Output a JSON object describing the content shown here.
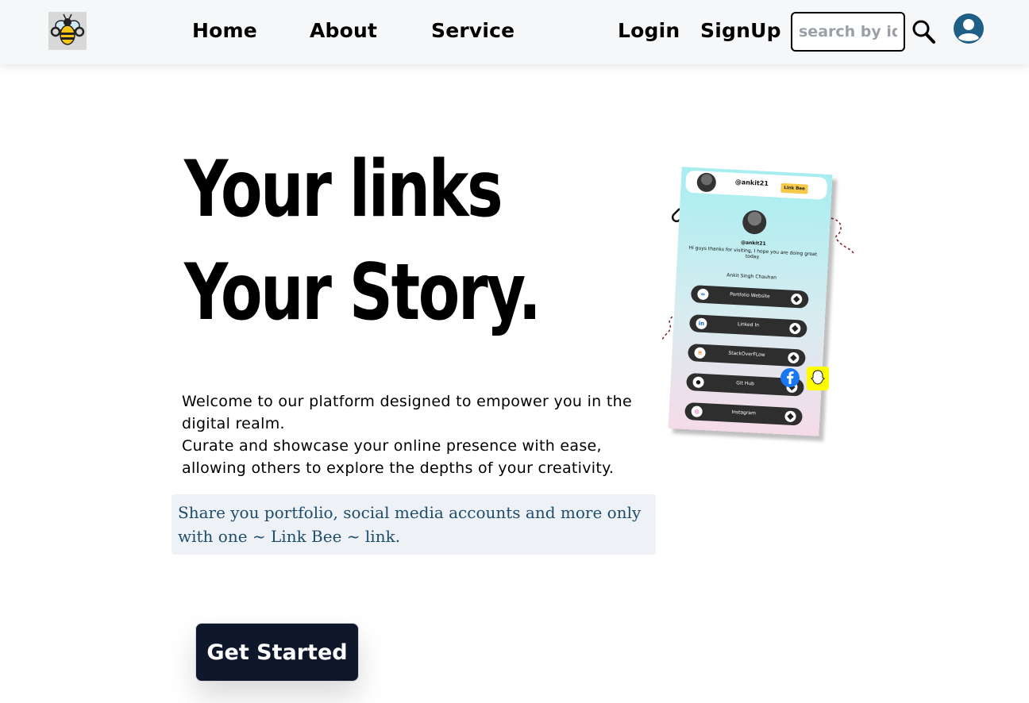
{
  "navbar": {
    "logo_alt": "bee logo",
    "links": [
      {
        "label": "Home"
      },
      {
        "label": "About"
      },
      {
        "label": "Service"
      }
    ],
    "login_label": "Login",
    "signup_label": "SignUp",
    "search": {
      "placeholder": "search by id",
      "value": ""
    },
    "icons": {
      "search": "search-icon",
      "profile": "user-circle-icon"
    }
  },
  "hero": {
    "line1": "Your links",
    "line2": "Your Story.",
    "description": [
      "Welcome to our platform designed to empower you in the digital realm.",
      "Curate and showcase your online presence with ease, allowing others to explore the depths of your creativity."
    ],
    "note": "Share you portfolio, social media accounts and more only with one ~ Link Bee ~ link.",
    "cta_label": "Get Started"
  },
  "mockup": {
    "username": "@ankit21",
    "badge": "Link Bee",
    "handle": "@ankit21",
    "bio": "Hi guys thanks for visiting, I hope you are doing great today.",
    "name": "Ankit Singh Chauhan",
    "links": [
      {
        "label": "Portfolio Website",
        "icon": "link-icon"
      },
      {
        "label": "Linked In",
        "icon": "linkedin-icon"
      },
      {
        "label": "StackOverFLow",
        "icon": "stackoverflow-icon"
      },
      {
        "label": "Git Hub",
        "icon": "github-icon"
      },
      {
        "label": "Instagram",
        "icon": "instagram-icon"
      }
    ]
  },
  "colors": {
    "navbar_bg": "#f6f7f9",
    "cta_bg": "#0f172a",
    "note_bg": "#eef2f7",
    "note_text": "#1d4d6b",
    "profile_icon": "#1f5e86"
  }
}
